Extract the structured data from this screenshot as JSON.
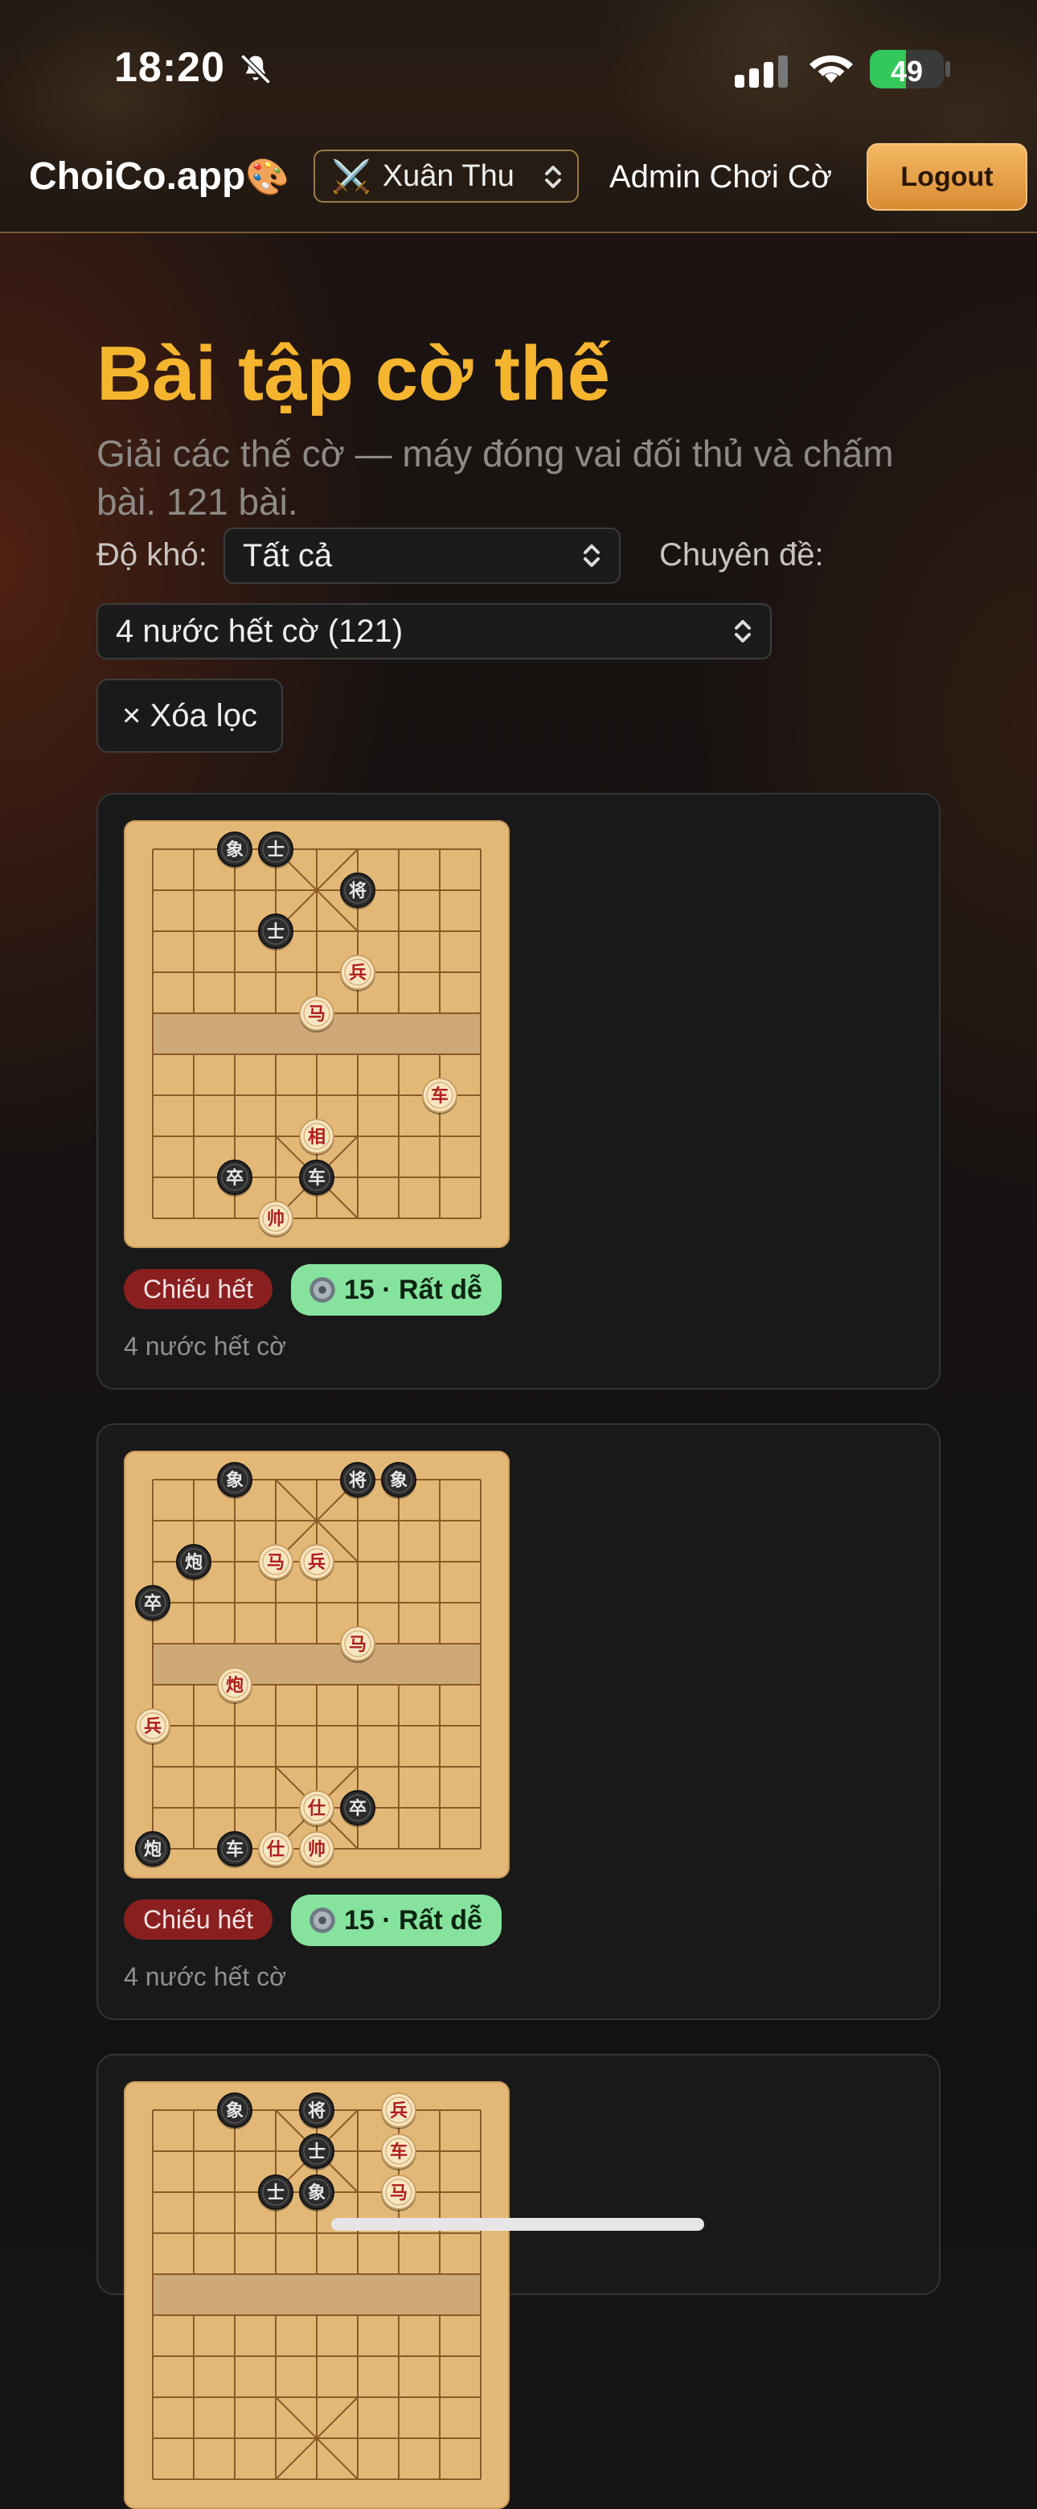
{
  "status_bar": {
    "time": "18:20",
    "battery": "49",
    "battery_level": 0.49
  },
  "header": {
    "brand": "ChoiCo.app",
    "brand_emoji": "🎨",
    "user_select_icon": "⚔️",
    "user_select_value": "Xuân Thu",
    "admin_name": "Admin Chơi Cờ",
    "logout_label": "Logout"
  },
  "page": {
    "title": "Bài tập cờ thế",
    "subtitle": "Giải các thế cờ — máy đóng vai đối thủ và chấm bài. 121 bài.",
    "difficulty_label": "Độ khó:",
    "difficulty_value": "Tất cả",
    "topic_label": "Chuyên đề:",
    "topic_value": "4 nước hết cờ (121)",
    "clear_filter": "× Xóa lọc"
  },
  "puzzles": [
    {
      "tag": "Chiếu hết",
      "difficulty": "15 · Rất dễ",
      "caption": "4 nước hết cờ",
      "pieces": [
        {
          "c": 2,
          "r": 0,
          "ch": "象",
          "side": "black"
        },
        {
          "c": 3,
          "r": 0,
          "ch": "士",
          "side": "black"
        },
        {
          "c": 5,
          "r": 1,
          "ch": "将",
          "side": "black"
        },
        {
          "c": 3,
          "r": 2,
          "ch": "士",
          "side": "black"
        },
        {
          "c": 5,
          "r": 3,
          "ch": "兵",
          "side": "red"
        },
        {
          "c": 4,
          "r": 4,
          "ch": "马",
          "side": "red"
        },
        {
          "c": 7,
          "r": 6,
          "ch": "车",
          "side": "red"
        },
        {
          "c": 4,
          "r": 7,
          "ch": "相",
          "side": "red"
        },
        {
          "c": 2,
          "r": 8,
          "ch": "卒",
          "side": "black"
        },
        {
          "c": 4,
          "r": 8,
          "ch": "车",
          "side": "black"
        },
        {
          "c": 3,
          "r": 9,
          "ch": "帅",
          "side": "red"
        }
      ]
    },
    {
      "tag": "Chiếu hết",
      "difficulty": "15 · Rất dễ",
      "caption": "4 nước hết cờ",
      "pieces": [
        {
          "c": 2,
          "r": 0,
          "ch": "象",
          "side": "black"
        },
        {
          "c": 5,
          "r": 0,
          "ch": "将",
          "side": "black"
        },
        {
          "c": 6,
          "r": 0,
          "ch": "象",
          "side": "black"
        },
        {
          "c": 1,
          "r": 2,
          "ch": "炮",
          "side": "black"
        },
        {
          "c": 3,
          "r": 2,
          "ch": "马",
          "side": "red"
        },
        {
          "c": 4,
          "r": 2,
          "ch": "兵",
          "side": "red"
        },
        {
          "c": 0,
          "r": 3,
          "ch": "卒",
          "side": "black"
        },
        {
          "c": 5,
          "r": 4,
          "ch": "马",
          "side": "red"
        },
        {
          "c": 2,
          "r": 5,
          "ch": "炮",
          "side": "red"
        },
        {
          "c": 0,
          "r": 6,
          "ch": "兵",
          "side": "red"
        },
        {
          "c": 4,
          "r": 8,
          "ch": "仕",
          "side": "red"
        },
        {
          "c": 5,
          "r": 8,
          "ch": "卒",
          "side": "black"
        },
        {
          "c": 0,
          "r": 9,
          "ch": "炮",
          "side": "black"
        },
        {
          "c": 2,
          "r": 9,
          "ch": "车",
          "side": "black"
        },
        {
          "c": 3,
          "r": 9,
          "ch": "仕",
          "side": "red"
        },
        {
          "c": 4,
          "r": 9,
          "ch": "帅",
          "side": "red"
        }
      ]
    },
    {
      "tag": "",
      "difficulty": "",
      "caption": "",
      "pieces": [
        {
          "c": 2,
          "r": 0,
          "ch": "象",
          "side": "black"
        },
        {
          "c": 4,
          "r": 0,
          "ch": "将",
          "side": "black"
        },
        {
          "c": 6,
          "r": 0,
          "ch": "兵",
          "side": "red"
        },
        {
          "c": 4,
          "r": 1,
          "ch": "士",
          "side": "black"
        },
        {
          "c": 6,
          "r": 1,
          "ch": "车",
          "side": "red"
        },
        {
          "c": 3,
          "r": 2,
          "ch": "士",
          "side": "black"
        },
        {
          "c": 4,
          "r": 2,
          "ch": "象",
          "side": "black"
        },
        {
          "c": 6,
          "r": 2,
          "ch": "马",
          "side": "red"
        }
      ]
    }
  ]
}
